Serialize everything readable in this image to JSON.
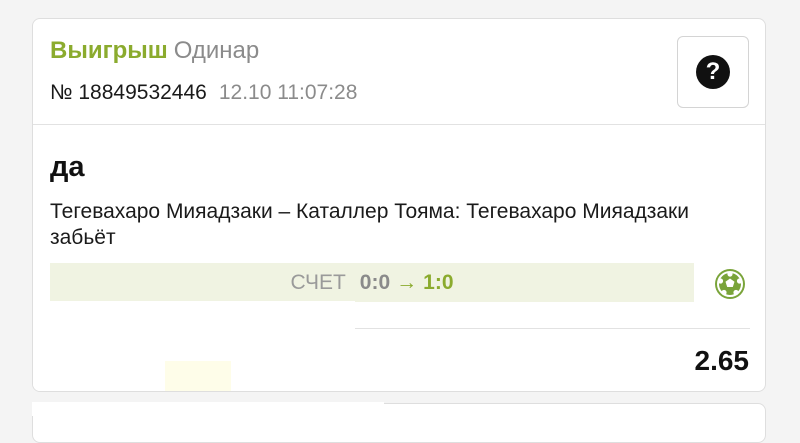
{
  "bet": {
    "status": "Выигрыш",
    "type": "Одинар",
    "ticket_number": "№ 18849532446",
    "datetime": "12.10 11:07:28",
    "help_label": "?",
    "selection": "да",
    "event": "Тегевахаро Мияадзаки – Каталлер Тояма: Тегевахаро Мияадзаки забьёт",
    "score_label": "СЧЕТ",
    "score_from": "0:0",
    "score_arrow": "→",
    "score_to": "1:0",
    "odds": "2.65",
    "sport_icon": "soccer-ball-icon"
  },
  "colors": {
    "win_green": "#8bab2e",
    "muted_gray": "#8b8b8b",
    "score_bar_bg": "#f0f3e2",
    "ball_green": "#7aa43a"
  }
}
